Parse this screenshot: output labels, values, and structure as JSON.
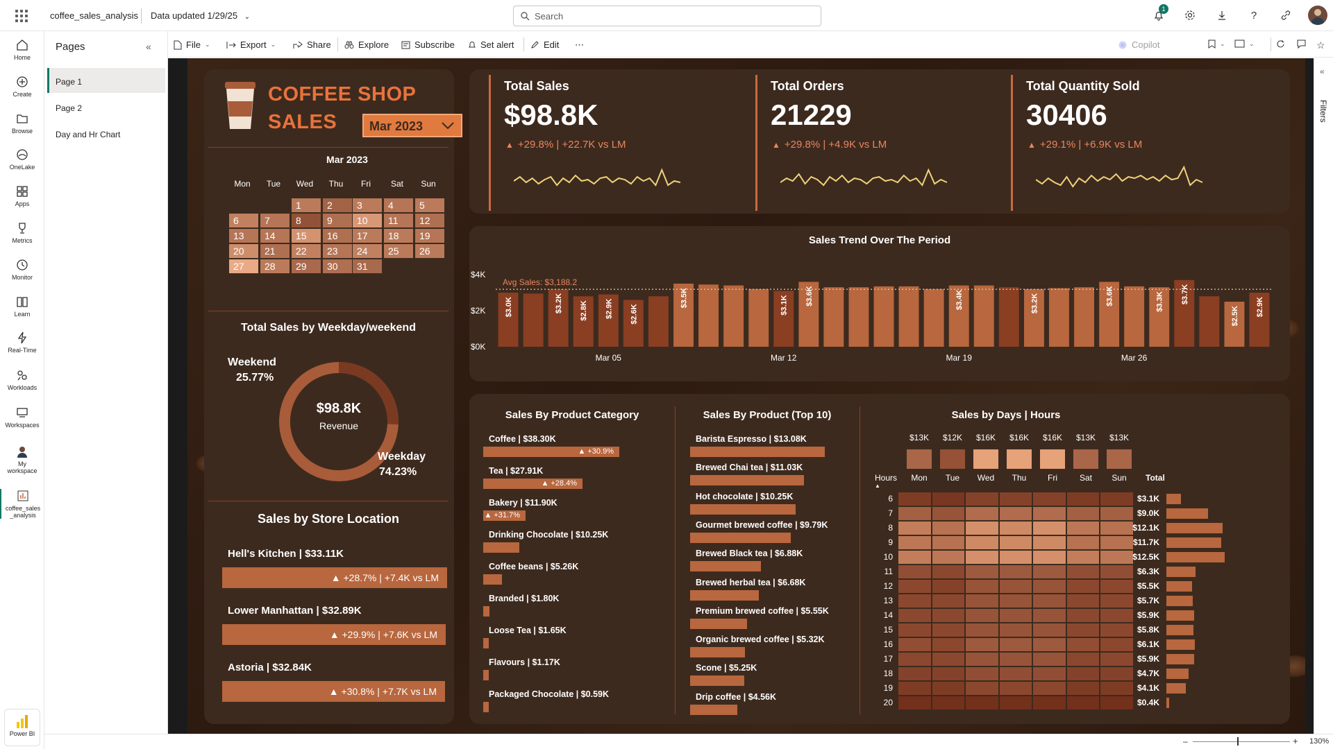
{
  "app": {
    "name": "coffee_sales_analysis",
    "data_updated": "Data updated 1/29/25",
    "search_placeholder": "Search",
    "notification_count": "1"
  },
  "rail": [
    {
      "label": "Home",
      "icon": "home-icon"
    },
    {
      "label": "Create",
      "icon": "plus-circle-icon"
    },
    {
      "label": "Browse",
      "icon": "folder-icon"
    },
    {
      "label": "OneLake",
      "icon": "onelake-icon"
    },
    {
      "label": "Apps",
      "icon": "apps-icon"
    },
    {
      "label": "Metrics",
      "icon": "trophy-icon"
    },
    {
      "label": "Monitor",
      "icon": "monitor-icon"
    },
    {
      "label": "Learn",
      "icon": "book-icon"
    },
    {
      "label": "Real-Time",
      "icon": "lightning-icon"
    },
    {
      "label": "Workloads",
      "icon": "workloads-icon"
    },
    {
      "label": "Workspaces",
      "icon": "workspaces-icon"
    },
    {
      "label1": "My",
      "label2": "workspace",
      "icon": "avatar-icon"
    },
    {
      "label1": "coffee_sales",
      "label2": "_analysis",
      "icon": "report-icon"
    }
  ],
  "powerbi_label": "Power BI",
  "pages": {
    "title": "Pages",
    "items": [
      "Page 1",
      "Page 2",
      "Day and Hr Chart"
    ]
  },
  "toolbar": {
    "file": "File",
    "export": "Export",
    "share": "Share",
    "explore": "Explore",
    "subscribe": "Subscribe",
    "set_alert": "Set alert",
    "edit": "Edit",
    "more": "⋯",
    "copilot": "Copilot"
  },
  "filters_label": "Filters",
  "zoom": "130%",
  "report": {
    "title_line1": "COFFEE SHOP",
    "title_line2": "SALES",
    "month_select": "Mar 2023",
    "calendar": {
      "title": "Mar 2023",
      "weekdays": [
        "Mon",
        "Tue",
        "Wed",
        "Thu",
        "Fri",
        "Sat",
        "Sun"
      ],
      "start_offset": 2,
      "days": 31,
      "intensity": [
        0.55,
        0.35,
        0.55,
        0.5,
        0.55,
        0.6,
        0.5,
        0.2,
        0.45,
        0.8,
        0.5,
        0.45,
        0.5,
        0.5,
        0.75,
        0.45,
        0.55,
        0.55,
        0.5,
        0.7,
        0.45,
        0.6,
        0.5,
        0.6,
        0.55,
        0.55,
        0.95,
        0.55,
        0.4,
        0.45,
        0.4
      ]
    },
    "kpis": [
      {
        "label": "Total Sales",
        "value": "$98.8K",
        "delta": "+29.8% | +22.7K vs LM",
        "spark": [
          0.45,
          0.6,
          0.4,
          0.55,
          0.35,
          0.5,
          0.6,
          0.3,
          0.55,
          0.4,
          0.65,
          0.45,
          0.5,
          0.35,
          0.55,
          0.6,
          0.4,
          0.55,
          0.5,
          0.35,
          0.6,
          0.45,
          0.55,
          0.3,
          0.85,
          0.3,
          0.45,
          0.4
        ]
      },
      {
        "label": "Total Orders",
        "value": "21229",
        "delta": "+29.8% | +4.9K vs LM",
        "spark": [
          0.4,
          0.55,
          0.45,
          0.7,
          0.35,
          0.6,
          0.5,
          0.3,
          0.6,
          0.45,
          0.65,
          0.4,
          0.55,
          0.5,
          0.35,
          0.55,
          0.6,
          0.45,
          0.5,
          0.4,
          0.65,
          0.45,
          0.55,
          0.3,
          0.85,
          0.35,
          0.5,
          0.4
        ]
      },
      {
        "label": "Total Quantity Sold",
        "value": "30406",
        "delta": "+29.1% | +6.9K vs LM",
        "spark": [
          0.5,
          0.35,
          0.55,
          0.4,
          0.3,
          0.6,
          0.25,
          0.55,
          0.4,
          0.65,
          0.45,
          0.6,
          0.5,
          0.7,
          0.45,
          0.6,
          0.55,
          0.65,
          0.5,
          0.6,
          0.45,
          0.65,
          0.5,
          0.55,
          0.95,
          0.3,
          0.5,
          0.4
        ]
      }
    ],
    "weekday_chart": {
      "title": "Total Sales by Weekday/weekend",
      "center_value": "$98.8K",
      "center_label": "Revenue",
      "weekend_label": "Weekend",
      "weekend_pct": "25.77%",
      "weekday_label": "Weekday",
      "weekday_pct": "74.23%"
    },
    "store_chart": {
      "title": "Sales by Store Location",
      "stores": [
        {
          "name": "Hell's Kitchen | $33.11K",
          "delta": "▲ +28.7% | +7.4K vs LM"
        },
        {
          "name": "Lower Manhattan | $32.89K",
          "delta": "▲ +29.9% | +7.6K vs LM"
        },
        {
          "name": "Astoria | $32.84K",
          "delta": "▲ +30.8% | +7.7K vs LM"
        }
      ]
    },
    "category_chart": {
      "title": "Sales By Product Category",
      "items": [
        {
          "name": "Coffee | $38.30K",
          "value": 38.3,
          "delta": "▲ +30.9%"
        },
        {
          "name": "Tea | $27.91K",
          "value": 27.91,
          "delta": "▲ +28.4%"
        },
        {
          "name": "Bakery | $11.90K",
          "value": 11.9,
          "delta": "▲ +31.7%"
        },
        {
          "name": "Drinking Chocolate | $10.25K",
          "value": 10.25,
          "delta": ""
        },
        {
          "name": "Coffee beans | $5.26K",
          "value": 5.26,
          "delta": ""
        },
        {
          "name": "Branded | $1.80K",
          "value": 1.8,
          "delta": ""
        },
        {
          "name": "Loose Tea | $1.65K",
          "value": 1.65,
          "delta": ""
        },
        {
          "name": "Flavours | $1.17K",
          "value": 1.17,
          "delta": ""
        },
        {
          "name": "Packaged Chocolate | $0.59K",
          "value": 0.59,
          "delta": ""
        }
      ]
    },
    "product_chart": {
      "title": "Sales By Product (Top 10)",
      "items": [
        {
          "name": "Barista Espresso | $13.08K",
          "value": 13.08
        },
        {
          "name": "Brewed Chai tea | $11.03K",
          "value": 11.03
        },
        {
          "name": "Hot chocolate | $10.25K",
          "value": 10.25
        },
        {
          "name": "Gourmet brewed coffee | $9.79K",
          "value": 9.79
        },
        {
          "name": "Brewed Black tea | $6.88K",
          "value": 6.88
        },
        {
          "name": "Brewed herbal tea | $6.68K",
          "value": 6.68
        },
        {
          "name": "Premium brewed coffee | $5.55K",
          "value": 5.55
        },
        {
          "name": "Organic brewed coffee | $5.32K",
          "value": 5.32
        },
        {
          "name": "Scone | $5.25K",
          "value": 5.25
        },
        {
          "name": "Drip coffee | $4.56K",
          "value": 4.56
        }
      ]
    },
    "heatmap": {
      "title": "Sales by Days | Hours",
      "hours_label": "Hours",
      "total_label": "Total",
      "days": [
        "Mon",
        "Tue",
        "Wed",
        "Thu",
        "Fri",
        "Sat",
        "Sun"
      ],
      "day_totals": [
        "$13K",
        "$12K",
        "$16K",
        "$16K",
        "$16K",
        "$13K",
        "$13K"
      ],
      "day_values": [
        13,
        12,
        16,
        16,
        16,
        13,
        13
      ],
      "hours": [
        "6",
        "7",
        "8",
        "9",
        "10",
        "11",
        "12",
        "13",
        "14",
        "15",
        "16",
        "17",
        "18",
        "19",
        "20"
      ],
      "hour_totals": [
        "$3.1K",
        "$9.0K",
        "$12.1K",
        "$11.7K",
        "$12.5K",
        "$6.3K",
        "$5.5K",
        "$5.7K",
        "$5.9K",
        "$5.8K",
        "$6.1K",
        "$5.9K",
        "$4.7K",
        "$4.1K",
        "$0.4K"
      ],
      "hour_values": [
        3.1,
        9.0,
        12.1,
        11.7,
        12.5,
        6.3,
        5.5,
        5.7,
        5.9,
        5.8,
        6.1,
        5.9,
        4.7,
        4.1,
        0.4
      ],
      "cells": [
        [
          0.15,
          0.1,
          0.2,
          0.2,
          0.2,
          0.15,
          0.15
        ],
        [
          0.45,
          0.35,
          0.55,
          0.55,
          0.55,
          0.45,
          0.45
        ],
        [
          0.7,
          0.6,
          0.85,
          0.8,
          0.85,
          0.65,
          0.6
        ],
        [
          0.65,
          0.6,
          0.8,
          0.8,
          0.8,
          0.6,
          0.6
        ],
        [
          0.7,
          0.65,
          0.85,
          0.85,
          0.85,
          0.7,
          0.65
        ],
        [
          0.3,
          0.25,
          0.4,
          0.4,
          0.4,
          0.3,
          0.3
        ],
        [
          0.25,
          0.2,
          0.35,
          0.35,
          0.35,
          0.25,
          0.25
        ],
        [
          0.25,
          0.25,
          0.35,
          0.35,
          0.35,
          0.25,
          0.25
        ],
        [
          0.25,
          0.25,
          0.35,
          0.35,
          0.35,
          0.25,
          0.25
        ],
        [
          0.25,
          0.25,
          0.35,
          0.35,
          0.35,
          0.25,
          0.25
        ],
        [
          0.3,
          0.25,
          0.4,
          0.4,
          0.4,
          0.3,
          0.25
        ],
        [
          0.25,
          0.25,
          0.35,
          0.35,
          0.35,
          0.25,
          0.25
        ],
        [
          0.2,
          0.2,
          0.3,
          0.3,
          0.3,
          0.2,
          0.2
        ],
        [
          0.15,
          0.15,
          0.25,
          0.25,
          0.25,
          0.15,
          0.15
        ],
        [
          0.05,
          0.05,
          0.05,
          0.05,
          0.05,
          0.05,
          0.05
        ]
      ]
    },
    "colors": {
      "accent": "#e07a3f",
      "card": "#3d2a1e",
      "bar_light": "#b8673e",
      "bar_dark": "#7a3a22",
      "spark": "#f0d27a"
    }
  },
  "chart_data": {
    "type": "bar",
    "title": "Sales Trend Over The Period",
    "ylim": [
      0,
      4000
    ],
    "yticks": [
      "$0K",
      "$2K",
      "$4K"
    ],
    "xticks": [
      "Mar 05",
      "Mar 12",
      "Mar 19",
      "Mar 26"
    ],
    "avg_label": "Avg Sales: $3,188.2",
    "avg_value": 3188.2,
    "categories": [
      "Mar 1",
      "Mar 2",
      "Mar 3",
      "Mar 4",
      "Mar 5",
      "Mar 6",
      "Mar 7",
      "Mar 8",
      "Mar 9",
      "Mar 10",
      "Mar 11",
      "Mar 12",
      "Mar 13",
      "Mar 14",
      "Mar 15",
      "Mar 16",
      "Mar 17",
      "Mar 18",
      "Mar 19",
      "Mar 20",
      "Mar 21",
      "Mar 22",
      "Mar 23",
      "Mar 24",
      "Mar 25",
      "Mar 26",
      "Mar 27",
      "Mar 28",
      "Mar 29",
      "Mar 30",
      "Mar 31"
    ],
    "values": [
      3000,
      2950,
      3200,
      2800,
      2900,
      2600,
      2800,
      3500,
      3450,
      3400,
      3200,
      3100,
      3600,
      3300,
      3300,
      3350,
      3350,
      3200,
      3400,
      3400,
      3300,
      3200,
      3250,
      3300,
      3600,
      3350,
      3300,
      3700,
      2800,
      2500,
      3000
    ],
    "labels": [
      "$3.0K",
      "",
      "$3.2K",
      "$2.8K",
      "$2.9K",
      "$2.6K",
      "",
      "$3.5K",
      "",
      "",
      "",
      "$3.1K",
      "$3.6K",
      "",
      "",
      "",
      "",
      "",
      "$3.4K",
      "",
      "",
      "$3.2K",
      "",
      "",
      "$3.6K",
      "",
      "$3.3K",
      "$3.7K",
      "",
      "$2.5K",
      "$2.9K"
    ]
  }
}
